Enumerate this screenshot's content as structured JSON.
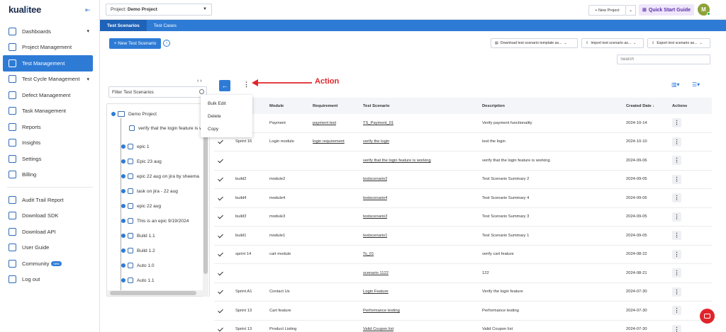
{
  "brand": {
    "logo_main": "kual",
    "logo_accent": "i",
    "logo_rest": "tee"
  },
  "sidebar": {
    "items": [
      {
        "label": "Dashboards",
        "icon": "dashboard-icon",
        "caret": "▾"
      },
      {
        "label": "Project Management",
        "icon": "project-icon"
      },
      {
        "label": "Test Management",
        "icon": "test-management-icon",
        "active": true
      },
      {
        "label": "Test Cycle Management",
        "icon": "test-cycle-icon",
        "caret": "▾"
      },
      {
        "label": "Defect Management",
        "icon": "defect-icon"
      },
      {
        "label": "Task Management",
        "icon": "task-icon"
      },
      {
        "label": "Reports",
        "icon": "reports-icon"
      },
      {
        "label": "Insights",
        "icon": "insights-icon"
      },
      {
        "label": "Settings",
        "icon": "settings-icon"
      },
      {
        "label": "Billing",
        "icon": "billing-icon"
      }
    ],
    "items2": [
      {
        "label": "Audit Trail Report",
        "icon": "audit-icon"
      },
      {
        "label": "Download SDK",
        "icon": "download-sdk-icon"
      },
      {
        "label": "Download API",
        "icon": "download-api-icon"
      },
      {
        "label": "User Guide",
        "icon": "user-guide-icon"
      },
      {
        "label": "Community",
        "icon": "community-icon",
        "badge": "new"
      },
      {
        "label": "Log out",
        "icon": "logout-icon"
      }
    ]
  },
  "topbar": {
    "project_label": "Project: ",
    "project_value": "Demo Project",
    "new_project": "+ New Project",
    "quick_start": "Quick Start Guide",
    "avatar_initial": "M"
  },
  "tabs": [
    {
      "label": "Test Scenarios",
      "active": true
    },
    {
      "label": "Test Cases"
    }
  ],
  "toolbar": {
    "new_scenario": "+ New Test Scenario",
    "download_template": "Download test scenario template as...",
    "import": "Import test scenario as...",
    "export": "Export test scenario as...",
    "search_placeholder": "Search"
  },
  "tree": {
    "filter_placeholder": "Filter Test Scenarios",
    "root": "Demo Project",
    "nodes": [
      "verify that the login feature is w",
      "epic 1",
      "Epic 23 aug",
      "epic 22 aug on jira by sheema",
      "task on jira - 22 aug",
      "epic 22 aug",
      "This is an epic 9/19/2024",
      "Build 1.1",
      "Build 1.2",
      "Auto 1.0",
      "Auto 1.1"
    ]
  },
  "menu": {
    "items": [
      "Bulk Edit",
      "Delete",
      "Copy"
    ]
  },
  "annotation": {
    "label": "Action"
  },
  "table": {
    "headers": {
      "module": "Module",
      "requirement": "Requirement",
      "scenario": "Test Scenario",
      "description": "Description",
      "created": "Created Date ↓",
      "actions": "Actions"
    },
    "rows": [
      {
        "checked": false,
        "build": "",
        "module": "Payment",
        "req": "payment test",
        "scenario": "TS_Payment_01",
        "desc": "Verify payment functionality",
        "date": "2024-10-14"
      },
      {
        "checked": true,
        "build": "Sprint 16",
        "module": "Login module",
        "req": "login requirement",
        "scenario": "verify the login",
        "desc": "test the login",
        "date": "2024-10-10"
      },
      {
        "checked": true,
        "build": "",
        "module": "",
        "req": "",
        "scenario": "verify that the login feature is working",
        "desc": "verify that the login feature is working",
        "date": "2024-09-06"
      },
      {
        "checked": true,
        "build": "build2",
        "module": "module2",
        "req": "",
        "scenario": "testscenario2",
        "desc": "Test Scenario Summary 2",
        "date": "2024-09-05"
      },
      {
        "checked": true,
        "build": "build4",
        "module": "module4",
        "req": "",
        "scenario": "testscenario4",
        "desc": "Test Scenario Summary 4",
        "date": "2024-09-05"
      },
      {
        "checked": true,
        "build": "build3",
        "module": "module3",
        "req": "",
        "scenario": "testscenario3",
        "desc": "Test Scenario Summary 3",
        "date": "2024-09-05"
      },
      {
        "checked": true,
        "build": "build1",
        "module": "module1",
        "req": "",
        "scenario": "testscenario1",
        "desc": "Test Scenario Summary 1",
        "date": "2024-09-05"
      },
      {
        "checked": true,
        "build": "sprint 14",
        "module": "cart module",
        "req": "",
        "scenario": "Ts_01",
        "desc": "verify cart feature",
        "date": "2024-08-22"
      },
      {
        "checked": true,
        "build": "",
        "module": "",
        "req": "",
        "scenario": "scenario 1122",
        "desc": "122",
        "date": "2024-08-21"
      },
      {
        "checked": true,
        "build": "Sprint A1",
        "module": "Contact Us",
        "req": "",
        "scenario": "Login Feature",
        "desc": "Verify the login feature",
        "date": "2024-07-30"
      },
      {
        "checked": true,
        "build": "Sprint 13",
        "module": "Cart feature",
        "req": "",
        "scenario": "Performance testing",
        "desc": "Performance testing",
        "date": "2024-07-30"
      },
      {
        "checked": true,
        "build": "Sprint 13",
        "module": "Product Listing",
        "req": "",
        "scenario": "Valid Coupon list",
        "desc": "Valid Coupon list",
        "date": "2024-07-30"
      }
    ],
    "action_glyph": "⋮"
  },
  "colors": {
    "primary": "#2e7bd6",
    "accent_red": "#e0242b",
    "quick_start_bg": "#efe6fb"
  }
}
